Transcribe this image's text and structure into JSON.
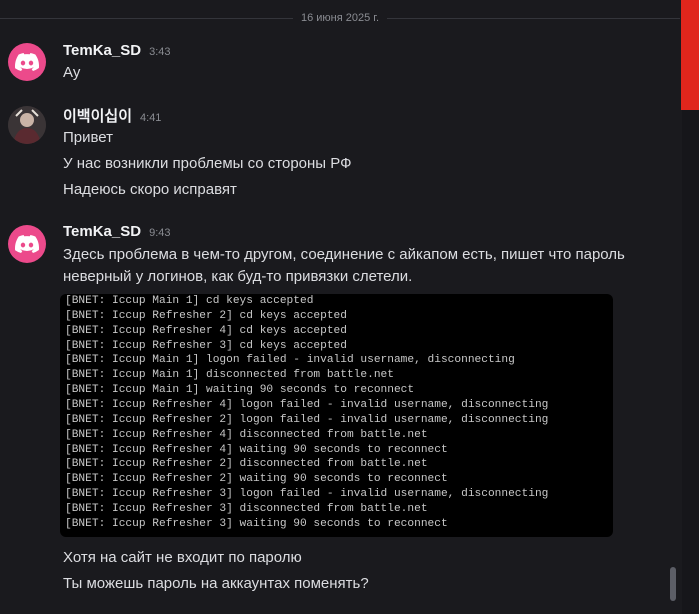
{
  "date_divider": "16 июня 2025 г.",
  "colors": {
    "accent_red": "#e0261c",
    "discord_avatar": "#ec4a8b",
    "background": "#1a1a1e"
  },
  "messages": [
    {
      "author": "TemKa_SD",
      "time": "3:43",
      "avatar": "discord-logo-icon",
      "lines": [
        "Ау"
      ]
    },
    {
      "author": "이백이십이",
      "time": "4:41",
      "avatar": "user-photo-avatar",
      "lines": [
        "Привет",
        "У нас возникли проблемы со стороны РФ",
        "Надеюсь скоро исправят"
      ]
    },
    {
      "author": "TemKa_SD",
      "time": "9:43",
      "avatar": "discord-logo-icon",
      "lines": [
        "Здесь проблема в чем-то другом, соединение с айкапом есть, пишет что пароль",
        "неверный у логинов, как буд-то привязки слетели."
      ],
      "code_lines": [
        "[BNET: Iccup Main 1] cd keys accepted",
        "[BNET: Iccup Refresher 2] cd keys accepted",
        "[BNET: Iccup Refresher 4] cd keys accepted",
        "[BNET: Iccup Refresher 3] cd keys accepted",
        "[BNET: Iccup Main 1] logon failed - invalid username, disconnecting",
        "[BNET: Iccup Main 1] disconnected from battle.net",
        "[BNET: Iccup Main 1] waiting 90 seconds to reconnect",
        "[BNET: Iccup Refresher 4] logon failed - invalid username, disconnecting",
        "[BNET: Iccup Refresher 2] logon failed - invalid username, disconnecting",
        "[BNET: Iccup Refresher 4] disconnected from battle.net",
        "[BNET: Iccup Refresher 4] waiting 90 seconds to reconnect",
        "[BNET: Iccup Refresher 2] disconnected from battle.net",
        "[BNET: Iccup Refresher 2] waiting 90 seconds to reconnect",
        "[BNET: Iccup Refresher 3] logon failed - invalid username, disconnecting",
        "[BNET: Iccup Refresher 3] disconnected from battle.net",
        "[BNET: Iccup Refresher 3] waiting 90 seconds to reconnect"
      ],
      "after_lines": [
        "Хотя на сайт не входит по паролю",
        "Ты можешь пароль на аккаунтах поменять?"
      ]
    }
  ]
}
